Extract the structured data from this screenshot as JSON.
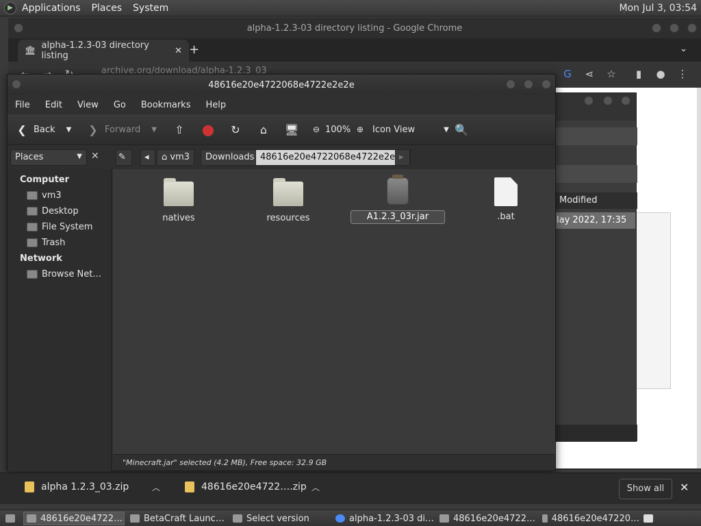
{
  "top_panel": {
    "menus": [
      "Applications",
      "Places",
      "System"
    ],
    "clock": "Mon Jul  3, 03:54"
  },
  "chrome": {
    "title": "alpha-1.2.3-03 directory listing - Google Chrome",
    "tab_title": "alpha-1.2.3-03 directory listing",
    "url": "archive.org/download/alpha-1.2.3_03"
  },
  "background_window": {
    "column_header": "Modified",
    "row_value": "lay 2022, 17:35"
  },
  "file_manager": {
    "title": "48616e20e4722068e4722e2e2e",
    "menubar": [
      "File",
      "Edit",
      "View",
      "Go",
      "Bookmarks",
      "Help"
    ],
    "toolbar": {
      "back": "Back",
      "forward": "Forward",
      "zoom": "100%",
      "view_mode": "Icon View"
    },
    "places_select": "Places",
    "breadcrumbs": [
      "vm3",
      "Downloads",
      "48616e20e4722068e4722e2e2e"
    ],
    "sidebar": {
      "computer_heading": "Computer",
      "computer_items": [
        "vm3",
        "Desktop",
        "File System",
        "Trash"
      ],
      "network_heading": "Network",
      "network_items": [
        "Browse Net…"
      ]
    },
    "items": [
      {
        "name": "natives",
        "type": "folder"
      },
      {
        "name": "resources",
        "type": "folder"
      },
      {
        "name": "A1.2.3_03r.jar",
        "type": "jar"
      },
      {
        "name": ".bat",
        "type": "file"
      }
    ],
    "status": "\"Minecraft.jar\" selected (4.2 MB), Free space: 32.9 GB"
  },
  "downloads_bar": {
    "items": [
      "alpha 1.2.3_03.zip",
      "48616e20e4722….zip"
    ],
    "show_all": "Show all"
  },
  "taskbar": {
    "tasks": [
      "48616e20e4722…",
      "BetaCraft Launc…",
      "Select version",
      "alpha-1.2.3-03 di…",
      "48616e20e4722…",
      "48616e20e47220…"
    ]
  }
}
